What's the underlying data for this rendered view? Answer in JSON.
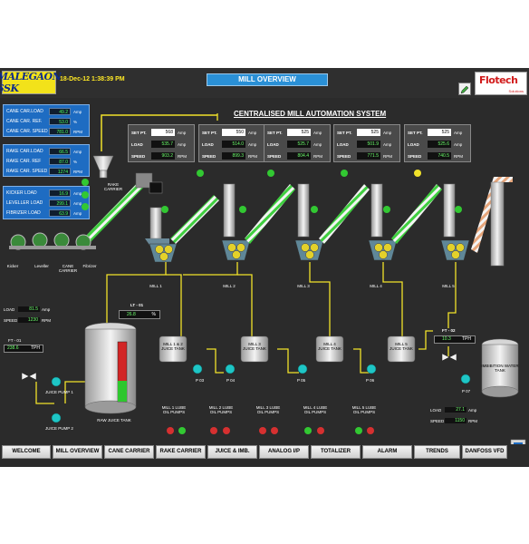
{
  "header": {
    "left_logo": "MALEGAON SSK",
    "datetime": "18-Dec-12 1:38:39 PM",
    "screen_title": "MILL OVERVIEW",
    "right_logo": "Flotech",
    "right_logo_sub": "Solutions",
    "system_title": "CENTRALISED MILL AUTOMATION SYSTEM"
  },
  "cane_panel": [
    {
      "label": "CANE CAR.LOAD",
      "value": "49.2",
      "unit": "Amp"
    },
    {
      "label": "CANE CAR. REF.",
      "value": "53.0",
      "unit": "%"
    },
    {
      "label": "CANE CAR. SPEED",
      "value": "781.0",
      "unit": "RPM"
    }
  ],
  "rake_panel": [
    {
      "label": "RAKE CAR.LOAD",
      "value": "66.5",
      "unit": "Amp"
    },
    {
      "label": "RAKE CAR. REF",
      "value": "87.0",
      "unit": "%"
    },
    {
      "label": "RAKE CAR. SPEED",
      "value": "1274",
      "unit": "RPM"
    }
  ],
  "kicker_panel": [
    {
      "label": "KICKER LOAD",
      "value": "16.9",
      "unit": "Amp"
    },
    {
      "label": "LEVELLER LOAD",
      "value": "299.1",
      "unit": "Amp"
    },
    {
      "label": "FIBRIZER LOAD",
      "value": "63.9",
      "unit": "Amp"
    }
  ],
  "mills": [
    {
      "name": "MILL 1",
      "setpt": "568",
      "load": "535.7",
      "speed": "903.2"
    },
    {
      "name": "MILL 2",
      "setpt": "550",
      "load": "514.0",
      "speed": "899.3"
    },
    {
      "name": "MILL 3",
      "setpt": "525",
      "load": "525.7",
      "speed": "804.4"
    },
    {
      "name": "MILL 4",
      "setpt": "525",
      "load": "501.9",
      "speed": "771.5"
    },
    {
      "name": "MILL 5",
      "setpt": "525",
      "load": "525.6",
      "speed": "740.5"
    }
  ],
  "mill_box_labels": {
    "setpt": "SET PT.",
    "load": "LOAD",
    "speed": "SPEED",
    "amp": "Amp",
    "rpm": "RPM"
  },
  "labels": {
    "rake_carrier": "RAKE CARRIER",
    "kicker": "Kicker",
    "leveller": "Leveller",
    "cane_carrier": "CANE CARRIER",
    "fibrizer": "Fibrizer",
    "raw_juice_tank": "RAW JUICE TANK",
    "juice_pump_1": "JUICE PUMP 1",
    "juice_pump_2": "JUICE PUMP 2",
    "imbibition_tank": "IMBIBITION WATER TANK",
    "tank_12": "MILL 1 & 2 JUICE TANK",
    "tank_3": "MILL 3 JUICE TANK",
    "tank_4": "MILL 4 JUICE TANK",
    "tank_5": "MILL 5 JUICE TANK"
  },
  "lube_pumps": [
    "MILL 1 LUBE OIL PUMPS",
    "MILL 2 LUBE OIL PUMPS",
    "MILL 3 LUBE OIL PUMPS",
    "MILL 4 LUBE OIL PUMPS",
    "MILL 5 LUBE OIL PUMPS"
  ],
  "pumps": [
    "P 03",
    "P 04",
    "P 05",
    "P 06",
    "P 07"
  ],
  "juice_pump_panel": {
    "load_label": "LOAD",
    "load": "81.5",
    "load_unit": "Amp",
    "speed_label": "SPEED",
    "speed": "1230",
    "speed_unit": "RPM"
  },
  "ft01": {
    "tag": "FT - 01",
    "value": "238.6",
    "unit": "TPH"
  },
  "lt01": {
    "tag": "LT - 01",
    "value": "26.8",
    "unit": "%"
  },
  "ft02": {
    "tag": "FT - 02",
    "value": "10.3",
    "unit": "TPH"
  },
  "p07_panel": {
    "load_label": "LOAD",
    "load": "27.1",
    "load_unit": "Amp",
    "speed_label": "SPEED",
    "speed": "1150",
    "speed_unit": "RPM"
  },
  "raw_tank_level": 0.65,
  "nav": [
    "WELCOME",
    "MILL OVERVIEW",
    "CANE CARRIER",
    "RAKE CARRIER",
    "JUICE & IMB.",
    "ANALOG I/P",
    "TOTALIZER",
    "ALARM",
    "TRENDS",
    "DANFOSS VFD"
  ],
  "colors": {
    "background": "#2b2b2b",
    "panel_blue": "#1e6cc2",
    "value_green": "#4cff5c",
    "pipe_yellow": "#f1e22a",
    "conveyor_green": "#39c43c"
  }
}
